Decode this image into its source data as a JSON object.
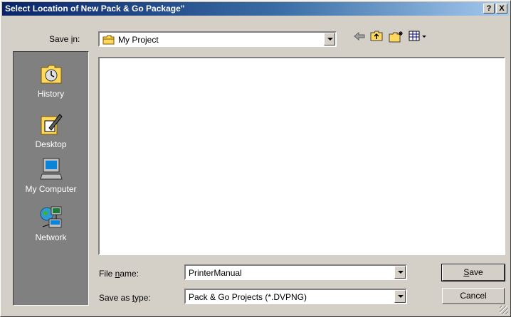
{
  "window": {
    "title": "Select Location of New Pack & Go Package\"",
    "help_btn": "?",
    "close_btn": "X"
  },
  "save_in": {
    "label_pre": "Save ",
    "label_u": "i",
    "label_post": "n:",
    "value": "My Project"
  },
  "places": [
    {
      "label": "History",
      "icon": "history-icon"
    },
    {
      "label": "Desktop",
      "icon": "desktop-icon"
    },
    {
      "label": "My Computer",
      "icon": "my-computer-icon"
    },
    {
      "label": "Network",
      "icon": "network-icon"
    }
  ],
  "file_name": {
    "label_pre": "File ",
    "label_u": "n",
    "label_post": "ame:",
    "value": "PrinterManual"
  },
  "save_type": {
    "label_pre": "Save as ",
    "label_u": "t",
    "label_post": "ype:",
    "value": "Pack & Go Projects (*.DVPNG)"
  },
  "buttons": {
    "save_u": "S",
    "save_rest": "ave",
    "cancel": "Cancel"
  }
}
